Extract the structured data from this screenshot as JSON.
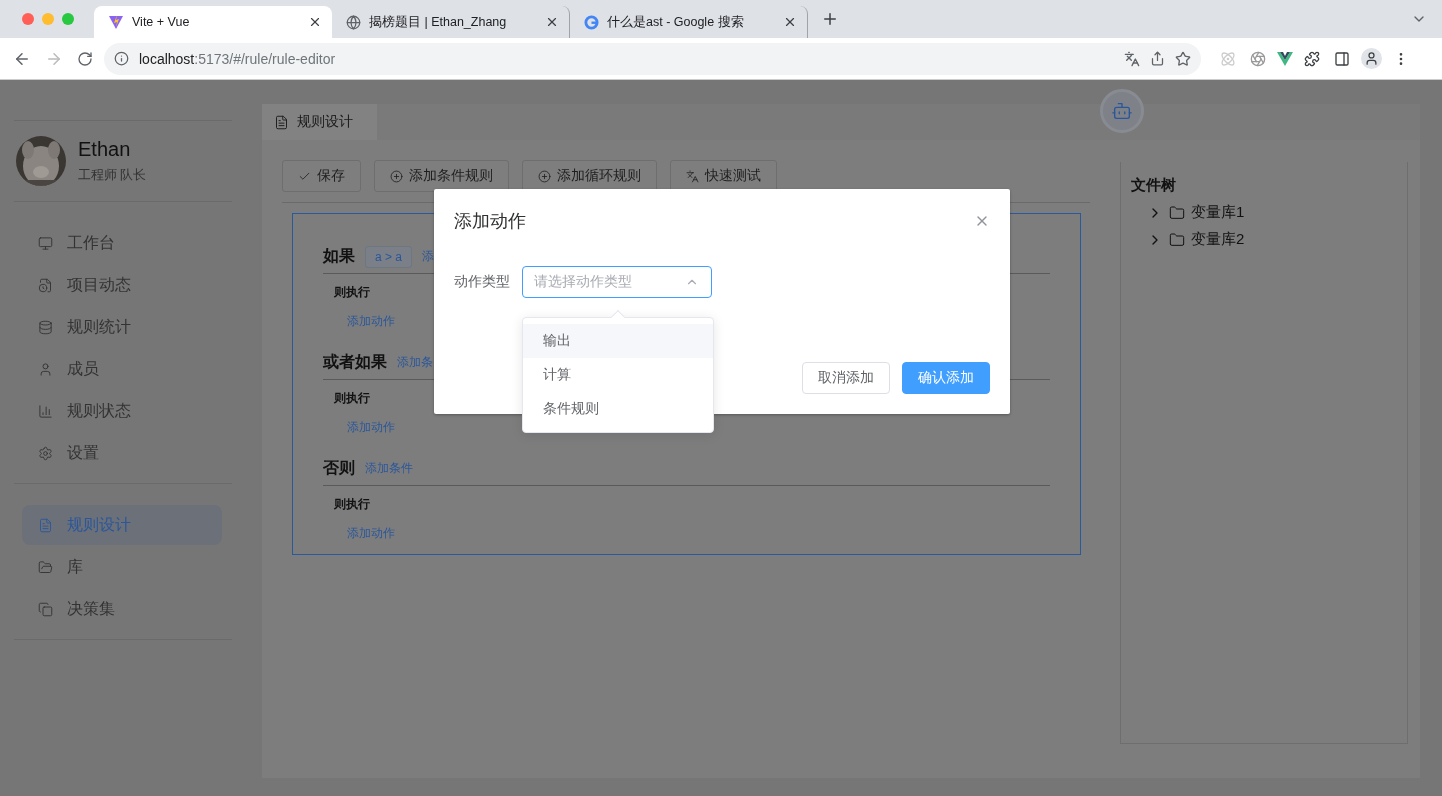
{
  "browser": {
    "tabs": [
      {
        "title": "Vite + Vue",
        "selected": true
      },
      {
        "title": "揭榜题目 | Ethan_Zhang",
        "selected": false
      },
      {
        "title": "什么是ast - Google 搜索",
        "selected": false
      }
    ],
    "url_host": "localhost",
    "url_path": ":5173/#/rule/rule-editor"
  },
  "sidebar": {
    "user": {
      "name": "Ethan",
      "role": "工程师 队长"
    },
    "menu_groups": [
      [
        {
          "label": "工作台",
          "selected": false
        },
        {
          "label": "项目动态",
          "selected": false
        },
        {
          "label": "规则统计",
          "selected": false
        },
        {
          "label": "成员",
          "selected": false
        },
        {
          "label": "规则状态",
          "selected": false
        },
        {
          "label": "设置",
          "selected": false
        }
      ],
      [
        {
          "label": "规则设计",
          "selected": true
        },
        {
          "label": "库",
          "selected": false
        },
        {
          "label": "决策集",
          "selected": false
        }
      ]
    ]
  },
  "main": {
    "tab": {
      "label": "规则设计"
    },
    "toolbar": [
      {
        "label": "保存",
        "kind": "check"
      },
      {
        "label": "添加条件规则",
        "kind": "plus"
      },
      {
        "label": "添加循环规则",
        "kind": "plus"
      },
      {
        "label": "快速测试",
        "kind": "test"
      }
    ],
    "sections": [
      {
        "title": "如果",
        "chip": "a > a",
        "link": "添",
        "then_label": "则执行",
        "action_link": "添加动作"
      },
      {
        "title": "或者如果",
        "link": "添加条",
        "then_label": "则执行",
        "action_link": "添加动作"
      },
      {
        "title": "否则",
        "link": "添加条件",
        "then_label": "则执行",
        "action_link": "添加动作"
      }
    ]
  },
  "file_tree": {
    "title": "文件树",
    "items": [
      {
        "label": "变量库1",
        "expanded": false
      },
      {
        "label": "变量库2",
        "expanded": false
      }
    ]
  },
  "dialog": {
    "title": "添加动作",
    "field_label": "动作类型",
    "select": {
      "placeholder": "请选择动作类型",
      "open": true
    },
    "options": [
      {
        "label": "输出",
        "highlighted": true
      },
      {
        "label": "计算",
        "highlighted": false
      },
      {
        "label": "条件规则",
        "highlighted": false
      }
    ],
    "buttons": [
      {
        "label": "取消添加",
        "kind": "default"
      },
      {
        "label": "确认添加",
        "kind": "primary"
      }
    ]
  }
}
